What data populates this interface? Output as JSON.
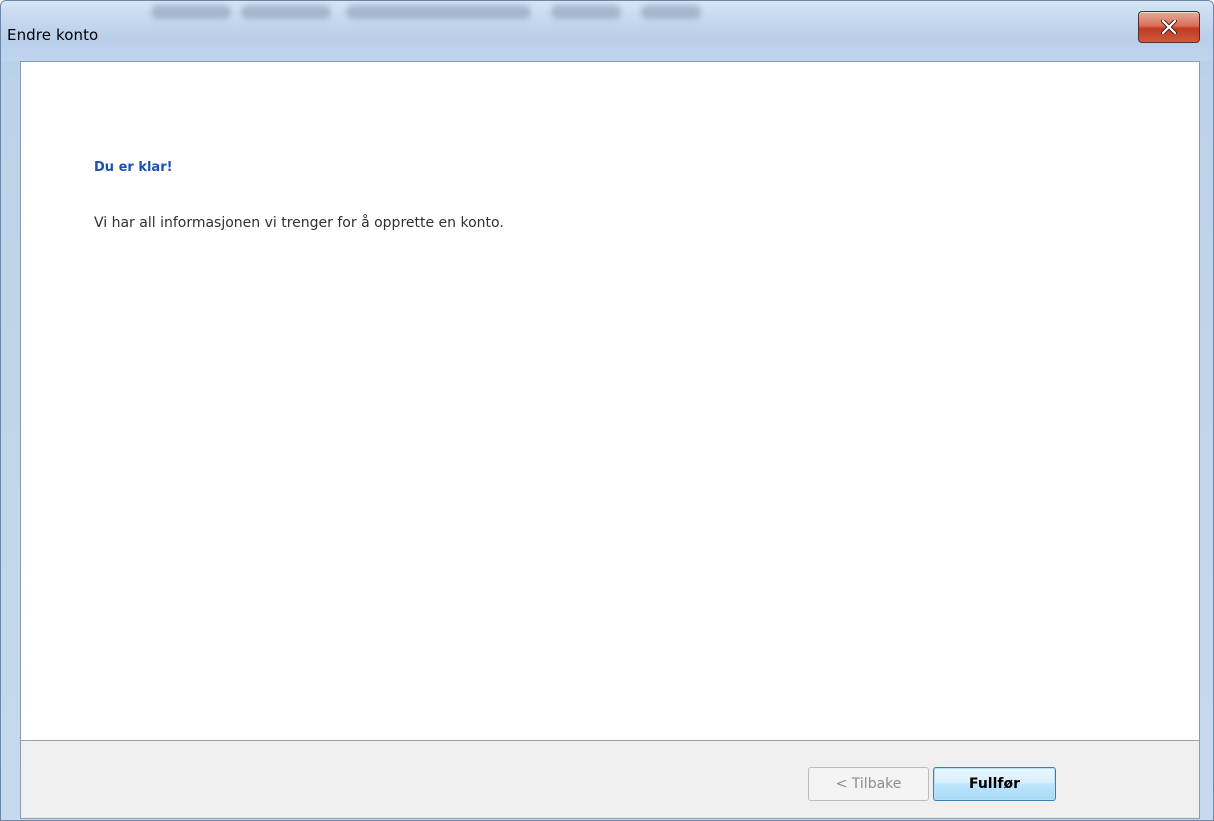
{
  "window": {
    "title": "Endre konto",
    "close_icon": "close-x-icon"
  },
  "content": {
    "heading": "Du er klar!",
    "message": "Vi har all informasjonen vi trenger for å opprette en konto."
  },
  "footer": {
    "back_label": "< Tilbake",
    "finish_label": "Fullfør"
  },
  "colors": {
    "heading": "#1e50b4",
    "close_button": "#c03a22",
    "footer_background": "#f0f0f0"
  }
}
